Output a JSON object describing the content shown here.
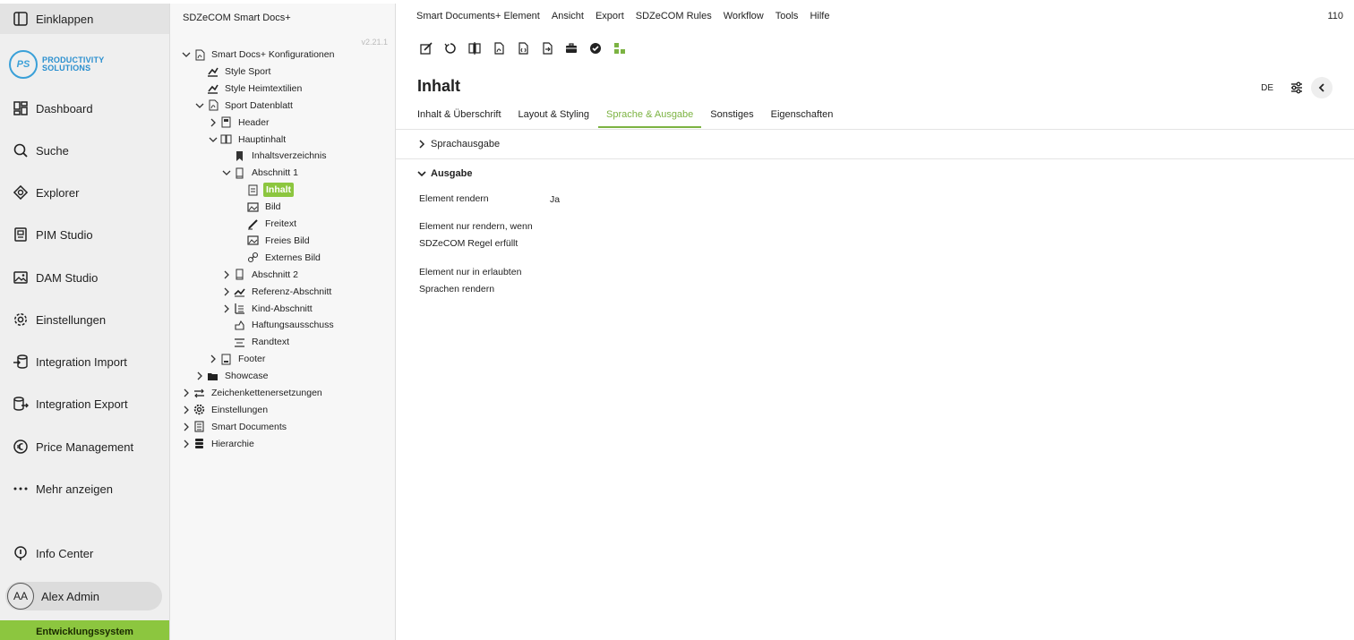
{
  "nav": {
    "collapse": "Einklappen",
    "logo": {
      "mark": "PS",
      "line1": "PRODUCTIVITY",
      "line2": "SOLUTIONS"
    },
    "items": [
      {
        "label": "Dashboard",
        "icon": "dashboard-icon"
      },
      {
        "label": "Suche",
        "icon": "search-icon"
      },
      {
        "label": "Explorer",
        "icon": "explorer-icon"
      },
      {
        "label": "PIM Studio",
        "icon": "pim-icon"
      },
      {
        "label": "DAM Studio",
        "icon": "image-icon"
      },
      {
        "label": "Einstellungen",
        "icon": "gear-icon"
      },
      {
        "label": "Integration Import",
        "icon": "import-icon"
      },
      {
        "label": "Integration Export",
        "icon": "export-icon"
      },
      {
        "label": "Price Management",
        "icon": "euro-icon"
      },
      {
        "label": "Mehr anzeigen",
        "icon": "more-icon"
      }
    ],
    "info": "Info Center",
    "user": {
      "initials": "AA",
      "name": "Alex Admin"
    },
    "env": "Entwicklungssystem"
  },
  "tree": {
    "title": "SDZeCOM Smart Docs+",
    "version": "v2.21.1",
    "nodes": [
      {
        "label": "Smart Docs+ Konfigurationen",
        "state": "open",
        "icon": "pdf-icon"
      },
      {
        "label": "Style Sport",
        "state": "leaf",
        "icon": "style-icon"
      },
      {
        "label": "Style Heimtextilien",
        "state": "leaf",
        "icon": "style-icon"
      },
      {
        "label": "Sport Datenblatt",
        "state": "open",
        "icon": "pdf-icon"
      },
      {
        "label": "Header",
        "state": "closed",
        "icon": "header-icon"
      },
      {
        "label": "Hauptinhalt",
        "state": "open",
        "icon": "book-icon"
      },
      {
        "label": "Inhaltsverzeichnis",
        "state": "leaf",
        "icon": "bookmark-icon"
      },
      {
        "label": "Abschnitt 1",
        "state": "open",
        "icon": "section-icon"
      },
      {
        "label": "Inhalt",
        "state": "leaf",
        "icon": "content-icon",
        "selected": true
      },
      {
        "label": "Bild",
        "state": "leaf",
        "icon": "image-icon"
      },
      {
        "label": "Freitext",
        "state": "leaf",
        "icon": "pen-icon"
      },
      {
        "label": "Freies Bild",
        "state": "leaf",
        "icon": "image-icon"
      },
      {
        "label": "Externes Bild",
        "state": "leaf",
        "icon": "link-icon"
      },
      {
        "label": "Abschnitt 2",
        "state": "closed",
        "icon": "section-icon"
      },
      {
        "label": "Referenz-Abschnitt",
        "state": "closed",
        "icon": "reference-icon"
      },
      {
        "label": "Kind-Abschnitt",
        "state": "closed",
        "icon": "child-icon"
      },
      {
        "label": "Haftungsausschuss",
        "state": "leaf",
        "icon": "disclaimer-icon"
      },
      {
        "label": "Randtext",
        "state": "leaf",
        "icon": "margin-text-icon"
      },
      {
        "label": "Footer",
        "state": "closed",
        "icon": "footer-icon"
      },
      {
        "label": "Showcase",
        "state": "closed",
        "icon": "folder-icon"
      },
      {
        "label": "Zeichenkettenersetzungen",
        "state": "closed",
        "icon": "swap-icon"
      },
      {
        "label": "Einstellungen",
        "state": "closed",
        "icon": "gear-icon"
      },
      {
        "label": "Smart Documents",
        "state": "closed",
        "icon": "document-icon"
      },
      {
        "label": "Hierarchie",
        "state": "closed",
        "icon": "database-icon"
      }
    ]
  },
  "main": {
    "menu": [
      "Smart Documents+ Element",
      "Ansicht",
      "Export",
      "SDZeCOM Rules",
      "Workflow",
      "Tools",
      "Hilfe"
    ],
    "counter": "110",
    "toolbar": [
      "edit-icon",
      "refresh-icon",
      "compare-icon",
      "pdf-icon",
      "code-icon",
      "export-file-icon",
      "briefcase-icon",
      "check-circle-icon",
      "tree-structure-icon"
    ],
    "title": "Inhalt",
    "lang": "DE",
    "tabs": [
      "Inhalt & Überschrift",
      "Layout & Styling",
      "Sprache & Ausgabe",
      "Sonstiges",
      "Eigenschaften"
    ],
    "active_tab": 2,
    "sections": {
      "sprachausgabe": "Sprachausgabe",
      "ausgabe": "Ausgabe"
    },
    "fields": {
      "render_label": "Element rendern",
      "render_value": "Ja",
      "rule_label_1": "Element nur rendern, wenn",
      "rule_label_2": "SDZeCOM Regel erfüllt",
      "lang_label_1": "Element nur in erlaubten",
      "lang_label_2": "Sprachen rendern"
    }
  },
  "colors": {
    "accent": "#8cc63f",
    "accent_text": "#7cb342",
    "logo": "#3aa0d8"
  }
}
